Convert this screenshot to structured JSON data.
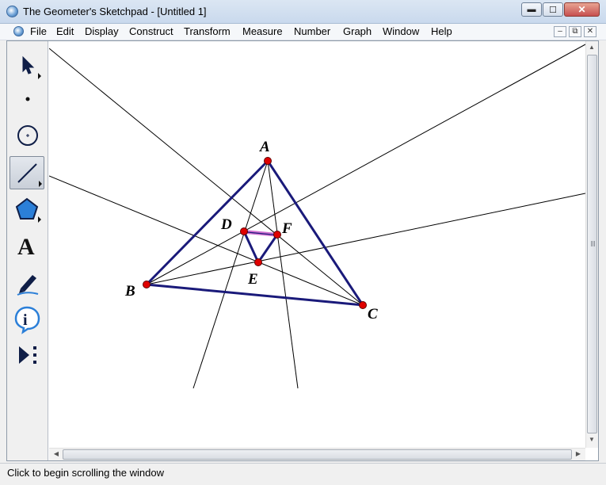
{
  "window": {
    "title": "The Geometer's Sketchpad - [Untitled 1]",
    "caption_minimize": "▬",
    "caption_maximize": "☐",
    "caption_close": "✕"
  },
  "menu": {
    "items": [
      "File",
      "Edit",
      "Display",
      "Construct",
      "Transform",
      "Measure",
      "Number",
      "Graph",
      "Window",
      "Help"
    ],
    "mdi_minimize": "–",
    "mdi_restore": "⧉",
    "mdi_close": "✕"
  },
  "toolbox": {
    "tools": [
      {
        "name": "arrow-tool-icon",
        "active": false
      },
      {
        "name": "point-tool-icon",
        "active": false
      },
      {
        "name": "compass-tool-icon",
        "active": false
      },
      {
        "name": "straightedge-tool-icon",
        "active": true
      },
      {
        "name": "polygon-tool-icon",
        "active": false
      },
      {
        "name": "text-tool-icon",
        "glyph": "A",
        "active": false
      },
      {
        "name": "marker-tool-icon",
        "active": false
      },
      {
        "name": "information-tool-icon",
        "glyph": "i",
        "active": false
      },
      {
        "name": "custom-tool-icon",
        "active": false
      }
    ]
  },
  "sketch": {
    "points": {
      "A": {
        "label": "A"
      },
      "B": {
        "label": "B"
      },
      "C": {
        "label": "C"
      },
      "D": {
        "label": "D"
      },
      "E": {
        "label": "E"
      },
      "F": {
        "label": "F"
      }
    },
    "colors": {
      "triangle": "#1a1a7a",
      "point_fill": "#e00000",
      "construction_line": "#000000",
      "highlight": "#d070d0"
    }
  },
  "status": {
    "text": "Click to begin scrolling the window"
  }
}
